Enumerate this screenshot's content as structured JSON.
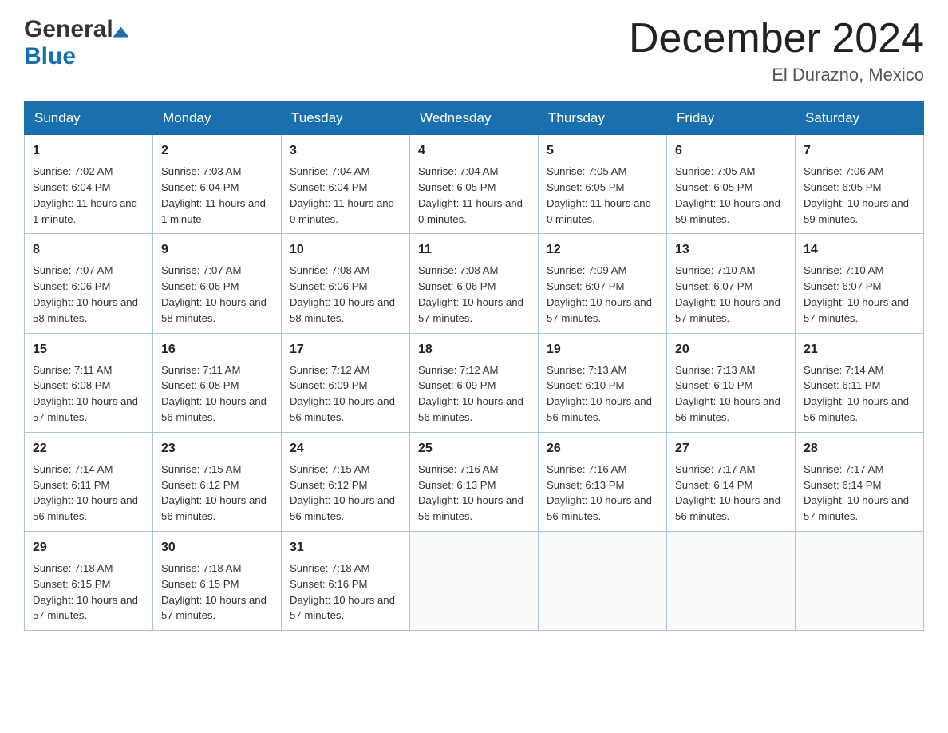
{
  "header": {
    "logo_general": "General",
    "logo_blue": "Blue",
    "month_year": "December 2024",
    "location": "El Durazno, Mexico"
  },
  "days_of_week": [
    "Sunday",
    "Monday",
    "Tuesday",
    "Wednesday",
    "Thursday",
    "Friday",
    "Saturday"
  ],
  "weeks": [
    [
      {
        "day": "1",
        "sunrise": "7:02 AM",
        "sunset": "6:04 PM",
        "daylight": "11 hours and 1 minute."
      },
      {
        "day": "2",
        "sunrise": "7:03 AM",
        "sunset": "6:04 PM",
        "daylight": "11 hours and 1 minute."
      },
      {
        "day": "3",
        "sunrise": "7:04 AM",
        "sunset": "6:04 PM",
        "daylight": "11 hours and 0 minutes."
      },
      {
        "day": "4",
        "sunrise": "7:04 AM",
        "sunset": "6:05 PM",
        "daylight": "11 hours and 0 minutes."
      },
      {
        "day": "5",
        "sunrise": "7:05 AM",
        "sunset": "6:05 PM",
        "daylight": "11 hours and 0 minutes."
      },
      {
        "day": "6",
        "sunrise": "7:05 AM",
        "sunset": "6:05 PM",
        "daylight": "10 hours and 59 minutes."
      },
      {
        "day": "7",
        "sunrise": "7:06 AM",
        "sunset": "6:05 PM",
        "daylight": "10 hours and 59 minutes."
      }
    ],
    [
      {
        "day": "8",
        "sunrise": "7:07 AM",
        "sunset": "6:06 PM",
        "daylight": "10 hours and 58 minutes."
      },
      {
        "day": "9",
        "sunrise": "7:07 AM",
        "sunset": "6:06 PM",
        "daylight": "10 hours and 58 minutes."
      },
      {
        "day": "10",
        "sunrise": "7:08 AM",
        "sunset": "6:06 PM",
        "daylight": "10 hours and 58 minutes."
      },
      {
        "day": "11",
        "sunrise": "7:08 AM",
        "sunset": "6:06 PM",
        "daylight": "10 hours and 57 minutes."
      },
      {
        "day": "12",
        "sunrise": "7:09 AM",
        "sunset": "6:07 PM",
        "daylight": "10 hours and 57 minutes."
      },
      {
        "day": "13",
        "sunrise": "7:10 AM",
        "sunset": "6:07 PM",
        "daylight": "10 hours and 57 minutes."
      },
      {
        "day": "14",
        "sunrise": "7:10 AM",
        "sunset": "6:07 PM",
        "daylight": "10 hours and 57 minutes."
      }
    ],
    [
      {
        "day": "15",
        "sunrise": "7:11 AM",
        "sunset": "6:08 PM",
        "daylight": "10 hours and 57 minutes."
      },
      {
        "day": "16",
        "sunrise": "7:11 AM",
        "sunset": "6:08 PM",
        "daylight": "10 hours and 56 minutes."
      },
      {
        "day": "17",
        "sunrise": "7:12 AM",
        "sunset": "6:09 PM",
        "daylight": "10 hours and 56 minutes."
      },
      {
        "day": "18",
        "sunrise": "7:12 AM",
        "sunset": "6:09 PM",
        "daylight": "10 hours and 56 minutes."
      },
      {
        "day": "19",
        "sunrise": "7:13 AM",
        "sunset": "6:10 PM",
        "daylight": "10 hours and 56 minutes."
      },
      {
        "day": "20",
        "sunrise": "7:13 AM",
        "sunset": "6:10 PM",
        "daylight": "10 hours and 56 minutes."
      },
      {
        "day": "21",
        "sunrise": "7:14 AM",
        "sunset": "6:11 PM",
        "daylight": "10 hours and 56 minutes."
      }
    ],
    [
      {
        "day": "22",
        "sunrise": "7:14 AM",
        "sunset": "6:11 PM",
        "daylight": "10 hours and 56 minutes."
      },
      {
        "day": "23",
        "sunrise": "7:15 AM",
        "sunset": "6:12 PM",
        "daylight": "10 hours and 56 minutes."
      },
      {
        "day": "24",
        "sunrise": "7:15 AM",
        "sunset": "6:12 PM",
        "daylight": "10 hours and 56 minutes."
      },
      {
        "day": "25",
        "sunrise": "7:16 AM",
        "sunset": "6:13 PM",
        "daylight": "10 hours and 56 minutes."
      },
      {
        "day": "26",
        "sunrise": "7:16 AM",
        "sunset": "6:13 PM",
        "daylight": "10 hours and 56 minutes."
      },
      {
        "day": "27",
        "sunrise": "7:17 AM",
        "sunset": "6:14 PM",
        "daylight": "10 hours and 56 minutes."
      },
      {
        "day": "28",
        "sunrise": "7:17 AM",
        "sunset": "6:14 PM",
        "daylight": "10 hours and 57 minutes."
      }
    ],
    [
      {
        "day": "29",
        "sunrise": "7:18 AM",
        "sunset": "6:15 PM",
        "daylight": "10 hours and 57 minutes."
      },
      {
        "day": "30",
        "sunrise": "7:18 AM",
        "sunset": "6:15 PM",
        "daylight": "10 hours and 57 minutes."
      },
      {
        "day": "31",
        "sunrise": "7:18 AM",
        "sunset": "6:16 PM",
        "daylight": "10 hours and 57 minutes."
      },
      null,
      null,
      null,
      null
    ]
  ],
  "labels": {
    "sunrise_prefix": "Sunrise: ",
    "sunset_prefix": "Sunset: ",
    "daylight_prefix": "Daylight: "
  }
}
